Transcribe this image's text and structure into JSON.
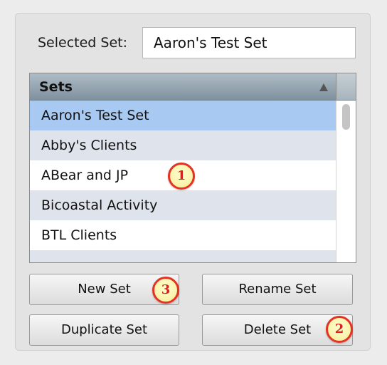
{
  "selected_set": {
    "label": "Selected Set:",
    "value": "Aaron's Test Set"
  },
  "sets_table": {
    "header": "Sets",
    "rows": [
      "Aaron's Test Set",
      "Abby's Clients",
      "ABear and JP",
      "Bicoastal Activity",
      "BTL Clients",
      ""
    ],
    "selected_index": 0
  },
  "buttons": {
    "new_set": "New Set",
    "rename_set": "Rename Set",
    "duplicate_set": "Duplicate Set",
    "delete_set": "Delete Set"
  },
  "callouts": [
    "1",
    "2",
    "3"
  ],
  "colors": {
    "selection": "#a8caf2",
    "header": "#8d9ea9",
    "callout_border": "#e53222"
  }
}
